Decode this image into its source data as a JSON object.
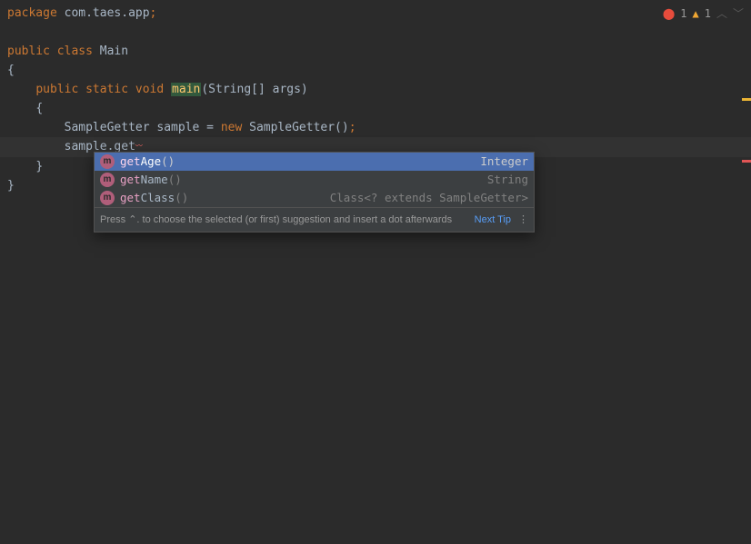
{
  "status": {
    "error_count": "1",
    "warning_count": "1"
  },
  "code": {
    "package_kw": "package",
    "package_name": " com.taes.app",
    "semi": ";",
    "public_kw": "public",
    "class_kw": "class",
    "class_name": "Main",
    "static_kw": "static",
    "void_kw": "void",
    "main_name": "main",
    "main_params": "(String[] args)",
    "open_brace": "{",
    "close_brace": "}",
    "sample_decl_a": "SampleGetter sample = ",
    "new_kw": "new",
    "sample_decl_b": " SampleGetter()",
    "sample_call": "sample.get"
  },
  "popup": {
    "items": [
      {
        "prefix": "get",
        "rest": "Age",
        "paren": "()",
        "rtype": "Integer"
      },
      {
        "prefix": "get",
        "rest": "Name",
        "paren": "()",
        "rtype": "String"
      },
      {
        "prefix": "get",
        "rest": "Class",
        "paren": "()",
        "rtype": "Class<? extends SampleGetter>"
      }
    ],
    "tip_prefix": "Press ",
    "tip_key": "⌃.",
    "tip_suffix": " to choose the selected (or first) suggestion and insert a dot afterwards",
    "next_tip": "Next Tip",
    "icon_letter": "m",
    "dots": "⋮"
  }
}
